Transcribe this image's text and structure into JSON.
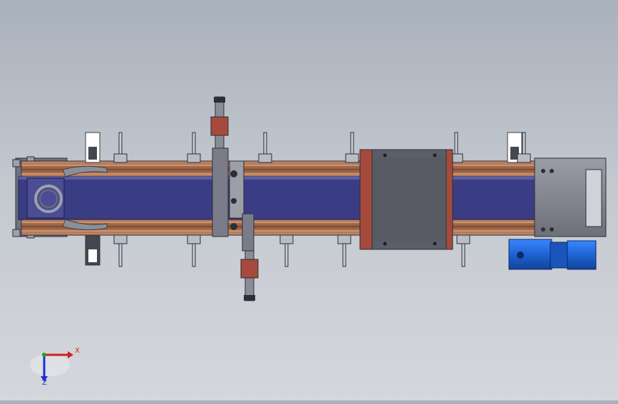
{
  "viewport": {
    "background_top": "#a9b1bc",
    "background_bottom": "#d4d7dc"
  },
  "model": {
    "frame_color": "#7a7d88",
    "belt_color": "#3a3d84",
    "rail_color": "#b0714f",
    "plate_color": "#5b5e66",
    "motor_color": "#1e63d1",
    "bracket_color": "#a54a3c"
  },
  "triad": {
    "x_label": "X",
    "z_label": "Z",
    "x_color": "#d21e1e",
    "y_color": "#1ea01e",
    "z_color": "#1e2fd2"
  }
}
